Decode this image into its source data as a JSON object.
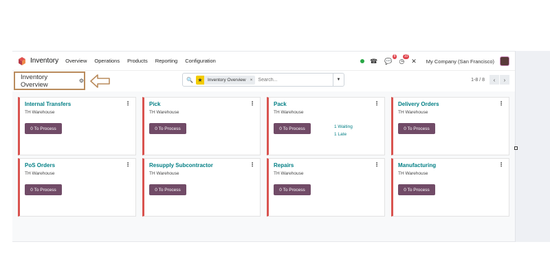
{
  "navbar": {
    "app_name": "Inventory",
    "menu": [
      "Overview",
      "Operations",
      "Products",
      "Reporting",
      "Configuration"
    ],
    "message_count": "8",
    "activity_count": "10",
    "company": "My Company (San Francisco)"
  },
  "control": {
    "breadcrumb": "Inventory Overview",
    "facet_label": "Inventory Overview",
    "search_placeholder": "Search...",
    "pager": "1-8 / 8"
  },
  "cards": [
    {
      "title": "Internal Transfers",
      "warehouse": "TH Warehouse",
      "button": "0 To Process",
      "stats": []
    },
    {
      "title": "Pick",
      "warehouse": "TH Warehouse",
      "button": "0 To Process",
      "stats": []
    },
    {
      "title": "Pack",
      "warehouse": "TH Warehouse",
      "button": "0 To Process",
      "stats": [
        "1 Waiting",
        "1 Late"
      ]
    },
    {
      "title": "Delivery Orders",
      "warehouse": "TH Warehouse",
      "button": "0 To Process",
      "stats": []
    },
    {
      "title": "PoS Orders",
      "warehouse": "TH Warehouse",
      "button": "0 To Process",
      "stats": []
    },
    {
      "title": "Resupply Subcontractor",
      "warehouse": "TH Warehouse",
      "button": "0 To Process",
      "stats": []
    },
    {
      "title": "Repairs",
      "warehouse": "TH Warehouse",
      "button": "0 To Process",
      "stats": []
    },
    {
      "title": "Manufacturing",
      "warehouse": "TH Warehouse",
      "button": "0 To Process",
      "stats": []
    }
  ],
  "colors": {
    "accent": "#714b67",
    "title_teal": "#017e84",
    "card_border": "#d9534f",
    "annotation": "#b98b5c",
    "status_green": "#28a745",
    "favorite_star": "#f3cc00"
  }
}
